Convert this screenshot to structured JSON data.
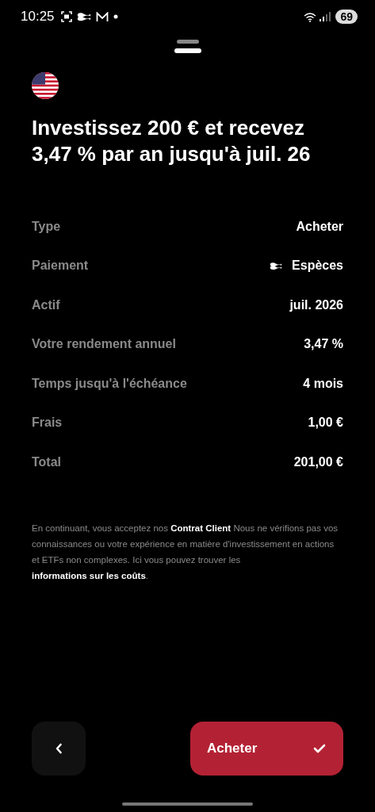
{
  "status_bar": {
    "time": "10:25",
    "battery": "69"
  },
  "title": "Investissez 200 € et recevez 3,47 % par an jusqu'à juil. 26",
  "details": [
    {
      "label": "Type",
      "value": "Acheter",
      "kind": "plain"
    },
    {
      "label": "Paiement",
      "value": "Espèces",
      "kind": "icon"
    },
    {
      "label": "Actif",
      "value": "juil. 2026",
      "kind": "plain"
    },
    {
      "label": "Votre rendement annuel",
      "value": "3,47 %",
      "kind": "plain"
    },
    {
      "label": "Temps jusqu'à l'échéance",
      "value": "4 mois",
      "kind": "plain"
    },
    {
      "label": "Frais",
      "value": "1,00 €",
      "kind": "plain"
    },
    {
      "label": "Total",
      "value": "201,00 €",
      "kind": "plain"
    }
  ],
  "disclaimer": [
    {
      "text": "En continuant, vous acceptez nos ",
      "kind": "text"
    },
    {
      "text": "Contrat Client",
      "kind": "link"
    },
    {
      "text": " Nous ne vérifions pas vos connaissances ou votre expérience en matière d'investissement en actions et ETFs non complexes. Ici vous pouvez trouver les ",
      "kind": "text"
    },
    {
      "text": "informations sur les coûts",
      "kind": "link"
    },
    {
      "text": ".",
      "kind": "text"
    }
  ],
  "buttons": {
    "confirm": "Acheter"
  }
}
